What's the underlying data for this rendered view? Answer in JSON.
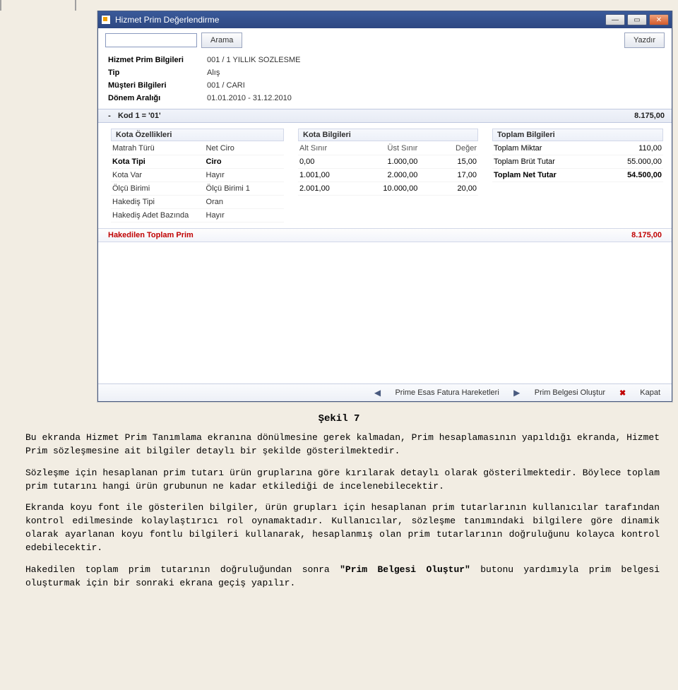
{
  "window": {
    "title": "Hizmet Prim Değerlendirme"
  },
  "toolbar": {
    "search_placeholder": "",
    "search_button": "Arama",
    "print_button": "Yazdır"
  },
  "info": {
    "rows": [
      {
        "label": "Hizmet Prim Bilgileri",
        "value": "001 / 1 YILLIK SOZLESME"
      },
      {
        "label": "Tip",
        "value": "Alış"
      },
      {
        "label": "Müşteri Bilgileri",
        "value": "001 / CARI"
      },
      {
        "label": "Dönem Aralığı",
        "value": "01.01.2010 - 31.12.2010"
      }
    ]
  },
  "group": {
    "toggle": "-",
    "label": "Kod 1 = '01'",
    "total": "8.175,00"
  },
  "kota_ozellikleri": {
    "title": "Kota Özellikleri",
    "rows": [
      {
        "k": "Matrah Türü",
        "v": "Net Ciro",
        "bold": false
      },
      {
        "k": "Kota Tipi",
        "v": "Ciro",
        "bold": true
      },
      {
        "k": "Kota Var",
        "v": "Hayır",
        "bold": false
      },
      {
        "k": "Ölçü Birimi",
        "v": "Ölçü Birimi 1",
        "bold": false
      },
      {
        "k": "Hakediş Tipi",
        "v": "Oran",
        "bold": false
      },
      {
        "k": "Hakediş Adet Bazında",
        "v": "Hayır",
        "bold": false
      }
    ]
  },
  "kota_bilgileri": {
    "title": "Kota Bilgileri",
    "headers": [
      "Alt Sınır",
      "Üst Sınır",
      "Değer"
    ],
    "rows": [
      [
        "0,00",
        "1.000,00",
        "15,00"
      ],
      [
        "1.001,00",
        "2.000,00",
        "17,00"
      ],
      [
        "2.001,00",
        "10.000,00",
        "20,00"
      ]
    ]
  },
  "toplam_bilgileri": {
    "title": "Toplam Bilgileri",
    "rows": [
      {
        "k": "Toplam Miktar",
        "v": "110,00",
        "bold": false
      },
      {
        "k": "Toplam Brüt Tutar",
        "v": "55.000,00",
        "bold": false
      },
      {
        "k": "Toplam Net Tutar",
        "v": "54.500,00",
        "bold": true
      }
    ]
  },
  "hakedilen": {
    "label": "Hakedilen Toplam Prim",
    "value": "8.175,00"
  },
  "footer": {
    "prev": "◀",
    "movements": "Prime Esas Fatura Hareketleri",
    "next": "▶",
    "create_doc": "Prim Belgesi Oluştur",
    "close_x": "✖",
    "close": "Kapat"
  },
  "doc": {
    "caption": "Şekil 7",
    "p1": "Bu ekranda Hizmet Prim Tanımlama ekranına dönülmesine gerek kalmadan, Prim hesaplamasının yapıldığı ekranda, Hizmet Prim sözleşmesine ait bilgiler detaylı bir şekilde gösterilmektedir.",
    "p2": "Sözleşme için hesaplanan prim tutarı ürün gruplarına göre kırılarak detaylı olarak gösterilmektedir. Böylece toplam prim tutarını hangi ürün grubunun ne kadar etkilediği de incelenebilecektir.",
    "p3": "Ekranda koyu font ile gösterilen bilgiler, ürün grupları için hesaplanan prim tutarlarının kullanıcılar tarafından kontrol edilmesinde kolaylaştırıcı rol oynamaktadır. Kullanıcılar, sözleşme tanımındaki bilgilere göre dinamik olarak ayarlanan koyu fontlu bilgileri kullanarak, hesaplanmış olan prim tutarlarının doğruluğunu kolayca kontrol edebilecektir.",
    "p4a": "Hakedilen toplam prim tutarının doğruluğundan sonra ",
    "p4b": "\"Prim Belgesi Oluştur\"",
    "p4c": " butonu yardımıyla prim belgesi oluşturmak için bir sonraki ekrana geçiş yapılır."
  }
}
